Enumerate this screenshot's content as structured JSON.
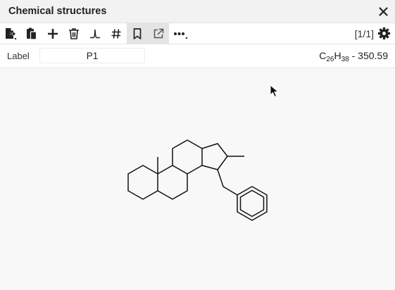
{
  "window": {
    "title": "Chemical structures"
  },
  "toolbar": {
    "icons": [
      "export-icon",
      "paste-icon",
      "add-icon",
      "delete-icon",
      "spectrum-icon",
      "numbering-icon",
      "bookmark-icon",
      "open-external-icon",
      "more-icon"
    ],
    "counter": "[1/1]"
  },
  "label_row": {
    "label": "Label",
    "value": "P1"
  },
  "formula": {
    "c": "C",
    "c_count": "26",
    "h": "H",
    "h_count": "38",
    "mass": " - 350.59"
  }
}
